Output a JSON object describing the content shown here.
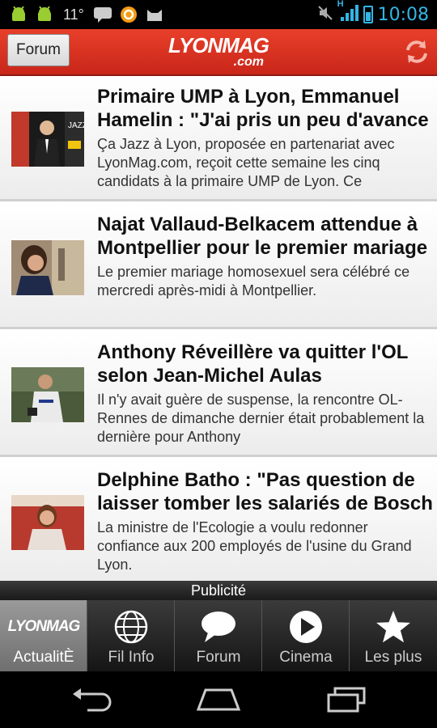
{
  "status_bar": {
    "temperature": "11°",
    "time": "10:08",
    "network": "H"
  },
  "header": {
    "forum_label": "Forum",
    "logo_main": "LYONMAG",
    "logo_sub": ".com"
  },
  "articles": [
    {
      "title": "Primaire UMP à Lyon, Emmanuel Hamelin : \"J'ai pris un peu d'avance",
      "snippet": "Ça Jazz à Lyon, proposée en partenariat avec LyonMag.com, reçoit cette semaine les cinq candidats à la primaire UMP de Lyon. Ce"
    },
    {
      "title": "Najat Vallaud-Belkacem attendue à Montpellier pour le premier mariage",
      "snippet": "Le premier mariage homosexuel sera célébré ce mercredi après-midi à Montpellier."
    },
    {
      "title": "Anthony Réveillère va quitter l'OL selon Jean-Michel Aulas",
      "snippet": "Il n'y avait guère de suspense, la rencontre OL-Rennes de dimanche dernier était probablement la dernière pour Anthony"
    },
    {
      "title": "Delphine Batho : \"Pas question de laisser tomber les salariés de Bosch",
      "snippet": "La ministre de l'Ecologie a voulu redonner confiance aux 200 employés de l'usine du Grand Lyon."
    }
  ],
  "ad_label": "Publicité",
  "tabs": [
    {
      "label": "ActualitÈ",
      "icon": "lyonmag-logo-icon",
      "logo_text": "LYONMAG"
    },
    {
      "label": "Fil Info",
      "icon": "globe-icon"
    },
    {
      "label": "Forum",
      "icon": "speech-bubble-icon"
    },
    {
      "label": "Cinema",
      "icon": "play-icon"
    },
    {
      "label": "Les plus",
      "icon": "star-icon"
    }
  ],
  "colors": {
    "header_red": "#d9301f",
    "status_blue": "#33b5e5"
  }
}
